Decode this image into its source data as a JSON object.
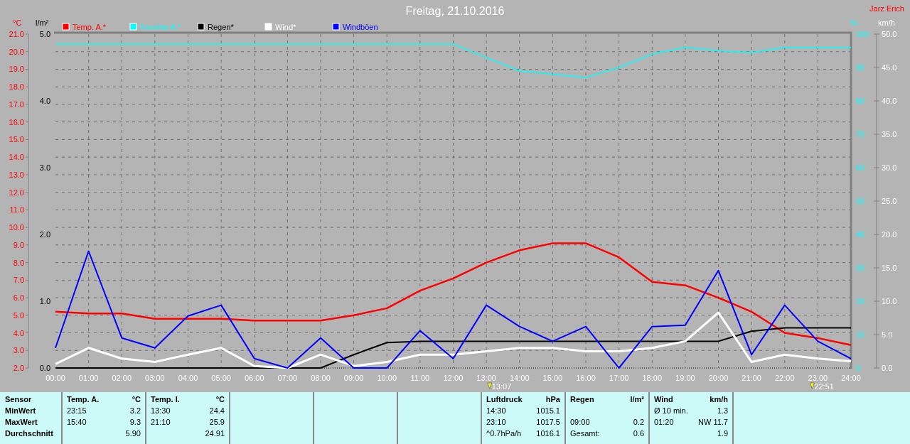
{
  "title": "Freitag, 21.10.2016",
  "author": "Jarz Erich",
  "main_chart": {
    "chart_data": {
      "type": "line",
      "xlim": [
        0,
        24
      ],
      "ylim": [
        2,
        21
      ],
      "ylabel": "°C",
      "y2lim": [
        0,
        5
      ],
      "y2label": "l/m²",
      "y3lim": [
        0,
        100
      ],
      "y3label": "%",
      "x": [
        0,
        1,
        2,
        3,
        4,
        5,
        6,
        7,
        8,
        9,
        10,
        11,
        12,
        13,
        14,
        15,
        16,
        17,
        18,
        19,
        20,
        21,
        22,
        23,
        24
      ],
      "xticks": [
        {
          "value": 0,
          "label": "00:00"
        },
        {
          "value": 1,
          "label": "01:00"
        },
        {
          "value": 2,
          "label": "02:00"
        },
        {
          "value": 3,
          "label": "03:00"
        },
        {
          "value": 4,
          "label": "04:00"
        },
        {
          "value": 5,
          "label": "05:00"
        },
        {
          "value": 6,
          "label": "06:00"
        },
        {
          "value": 7,
          "label": "07:00"
        },
        {
          "value": 8,
          "label": "08:00"
        },
        {
          "value": 9,
          "label": "09:00"
        },
        {
          "value": 10,
          "label": "10:00"
        },
        {
          "value": 11,
          "label": "11:00"
        },
        {
          "value": 12,
          "label": "12:00"
        },
        {
          "value": 13,
          "label": "13:00"
        },
        {
          "value": 14,
          "label": "14:00"
        },
        {
          "value": 15,
          "label": "15:00"
        },
        {
          "value": 16,
          "label": "16:00"
        },
        {
          "value": 17,
          "label": "17:00"
        },
        {
          "value": 18,
          "label": "18:00"
        },
        {
          "value": 19,
          "label": "19:00"
        },
        {
          "value": 20,
          "label": "20:00"
        },
        {
          "value": 21,
          "label": "21:00"
        },
        {
          "value": 22,
          "label": "22:00"
        },
        {
          "value": 23,
          "label": "23:00"
        },
        {
          "value": 24,
          "label": "24:00"
        }
      ],
      "yticks": [
        {
          "value": 2,
          "label": "2.0"
        },
        {
          "value": 3,
          "label": "3.0"
        },
        {
          "value": 4,
          "label": "4.0"
        },
        {
          "value": 5,
          "label": "5.0"
        },
        {
          "value": 6,
          "label": "6.0"
        },
        {
          "value": 7,
          "label": "7.0"
        },
        {
          "value": 8,
          "label": "8.0"
        },
        {
          "value": 9,
          "label": "9.0"
        },
        {
          "value": 10,
          "label": "10.0"
        },
        {
          "value": 11,
          "label": "11.0"
        },
        {
          "value": 12,
          "label": "12.0"
        },
        {
          "value": 13,
          "label": "13.0"
        },
        {
          "value": 14,
          "label": "14.0"
        },
        {
          "value": 15,
          "label": "15.0"
        },
        {
          "value": 16,
          "label": "16.0"
        },
        {
          "value": 17,
          "label": "17.0"
        },
        {
          "value": 18,
          "label": "18.0"
        },
        {
          "value": 19,
          "label": "19.0"
        },
        {
          "value": 20,
          "label": "20.0"
        },
        {
          "value": 21,
          "label": "21.0"
        }
      ],
      "y2ticks": [
        {
          "value": 0,
          "label": "0.0"
        },
        {
          "value": 1,
          "label": "1.0"
        },
        {
          "value": 2,
          "label": "2.0"
        },
        {
          "value": 3,
          "label": "3.0"
        },
        {
          "value": 4,
          "label": "4.0"
        },
        {
          "value": 5,
          "label": "5.0"
        }
      ],
      "y3ticks": [
        {
          "value": 0,
          "label": "0"
        },
        {
          "value": 10,
          "label": "10"
        },
        {
          "value": 20,
          "label": "20"
        },
        {
          "value": 30,
          "label": "30"
        },
        {
          "value": 40,
          "label": "40"
        },
        {
          "value": 50,
          "label": "50"
        },
        {
          "value": 60,
          "label": "60"
        },
        {
          "value": 70,
          "label": "70"
        },
        {
          "value": 80,
          "label": "80"
        },
        {
          "value": 90,
          "label": "90"
        },
        {
          "value": 100,
          "label": "100"
        }
      ],
      "series": [
        {
          "name": "Temp. A.*",
          "color": "#ff0000",
          "values": [
            5.2,
            5.1,
            5.1,
            4.8,
            4.8,
            4.8,
            4.7,
            4.7,
            4.7,
            5.0,
            5.4,
            6.4,
            7.1,
            8.0,
            8.7,
            9.1,
            9.1,
            8.3,
            6.9,
            6.7,
            6.0,
            5.2,
            4.0,
            3.7,
            3.3
          ]
        },
        {
          "name": "Feuchte A.*",
          "color": "#00ffff",
          "axis": "y3",
          "values": [
            97,
            97,
            97,
            97,
            97,
            97,
            97,
            97,
            97,
            97,
            97,
            97,
            97,
            93,
            89,
            88,
            87,
            90,
            94,
            96,
            95,
            94.5,
            96,
            96,
            96
          ]
        },
        {
          "name": "Regen*",
          "color": "#000000",
          "axis": "y2",
          "values": [
            0,
            0,
            0,
            0,
            0,
            0,
            0,
            0,
            0,
            0.2,
            0.38,
            0.4,
            0.4,
            0.4,
            0.4,
            0.4,
            0.4,
            0.4,
            0.4,
            0.4,
            0.4,
            0.55,
            0.6,
            0.6,
            0.6
          ]
        }
      ],
      "grid": true,
      "legend": "top",
      "annotations": [
        "13:07",
        "22:51"
      ]
    }
  },
  "wind_chart": {
    "chart_data": {
      "type": "line",
      "xlim": [
        0,
        24
      ],
      "ylim": [
        0,
        50
      ],
      "ylabel": "km/h",
      "legend": "top",
      "x": [
        0,
        1,
        2,
        3,
        4,
        5,
        6,
        7,
        8,
        9,
        10,
        11,
        12,
        13,
        14,
        15,
        16,
        17,
        18,
        19,
        20,
        21,
        22,
        23,
        24
      ],
      "yticks": [
        {
          "value": 0,
          "label": "0.0"
        },
        {
          "value": 5,
          "label": "5.0"
        },
        {
          "value": 10,
          "label": "10.0"
        },
        {
          "value": 15,
          "label": "15.0"
        },
        {
          "value": 20,
          "label": "20.0"
        },
        {
          "value": 25,
          "label": "25.0"
        },
        {
          "value": 30,
          "label": "30.0"
        },
        {
          "value": 35,
          "label": "35.0"
        },
        {
          "value": 40,
          "label": "40.0"
        },
        {
          "value": 45,
          "label": "45.0"
        },
        {
          "value": 50,
          "label": "50.0"
        }
      ],
      "series": [
        {
          "name": "Wind*",
          "color": "#ffffff",
          "values": [
            0.6,
            3,
            1.4,
            0.9,
            2,
            3,
            0.3,
            0,
            2,
            0.3,
            0.9,
            2,
            2,
            2.5,
            3,
            3,
            2.5,
            2.5,
            3,
            4,
            8.3,
            0.9,
            2,
            1.4,
            1
          ]
        },
        {
          "name": "Windböen",
          "color": "#0000ff",
          "values": [
            3,
            17.5,
            4.5,
            3,
            7.8,
            9.4,
            1.4,
            0,
            4.5,
            0,
            0,
            5.6,
            1.4,
            9.4,
            6.2,
            4,
            6.2,
            0,
            6.2,
            6.4,
            14.6,
            2,
            9.4,
            4,
            1.4
          ]
        }
      ]
    }
  },
  "stats": {
    "heading": "Sensor",
    "labels": [
      "MinWert",
      "MaxWert",
      "Durchschnitt"
    ],
    "left_panels": [
      {
        "heading": "Temp. A.",
        "unit": "°C",
        "rows": [
          {
            "time": "23:15",
            "value": "3.2"
          },
          {
            "time": "15:40",
            "value": "9.3"
          },
          {
            "value": "5.90"
          }
        ]
      },
      {
        "heading": "Temp. I.",
        "unit": "°C",
        "rows": [
          {
            "time": "13:30",
            "value": "24.4"
          },
          {
            "time": "21:10",
            "value": "25.9"
          },
          {
            "value": "24.91"
          }
        ]
      }
    ],
    "right_panels": [
      {
        "heading": "Luftdruck",
        "unit": "hPa",
        "rows": [
          {
            "time": "14:30",
            "value": "1015.1"
          },
          {
            "time": "23:10",
            "value": "1017.5"
          },
          {
            "time": "^0.7hPa/h",
            "value": "1016.1"
          }
        ]
      },
      {
        "heading": "Regen",
        "unit": "l/m²",
        "rows": [
          null,
          {
            "time": "09:00",
            "value": "0.2"
          },
          {
            "time": "Gesamt:",
            "value": "0.6"
          }
        ]
      },
      {
        "heading": "Wind",
        "unit": "km/h",
        "rows": [
          {
            "time": "Ø 10 min.",
            "value": "1.3"
          },
          {
            "time": "01:20",
            "value": "NW 11.7"
          },
          {
            "value": "1.9"
          }
        ]
      }
    ]
  }
}
